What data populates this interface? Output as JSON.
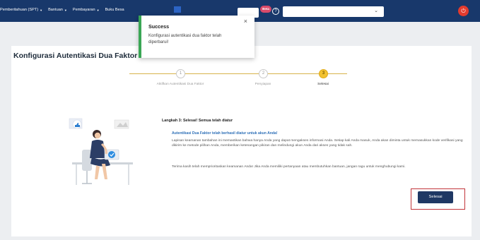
{
  "nav": {
    "items": [
      {
        "label": "Pemberitahuan (SPT)"
      },
      {
        "label": "Bantuan"
      },
      {
        "label": "Pembayaran"
      },
      {
        "label": "Buku Besa"
      }
    ],
    "badge_label": "Beta",
    "dropdown_value": "",
    "select_value": ""
  },
  "toast": {
    "title": "Success",
    "message": "Konfigurasi autentikasi dua faktor telah diperbarui!",
    "close_symbol": "×"
  },
  "page": {
    "title": "Konfigurasi Autentikasi Dua Faktor"
  },
  "stepper": {
    "steps": [
      {
        "number": "1",
        "label": "Aktifkan Autentikasi Dua Faktor",
        "state": "done"
      },
      {
        "number": "2",
        "label": "Penyiapan",
        "state": "done"
      },
      {
        "number": "3",
        "label": "Selesai",
        "state": "active"
      }
    ]
  },
  "content": {
    "step_heading": "Langkah 3: Selesai! Semua telah diatur",
    "sub_heading": "Autentikasi Dua Faktor telah berhasil diatur untuk akun Anda!",
    "paragraph1": "Lapisan keamanan tambahan ini memastikan bahwa hanya Anda yang dapat mengakses informasi Anda. Setiap kali Anda masuk, Anda akan diminta untuk memasukkan kode verifikasi yang dikirim ke metode pilihan Anda, memberikan ketenangan pikiran dan melindungi akun Anda dari akses yang tidak sah.",
    "paragraph2": "Terima kasih telah memprioritaskan keamanan Anda! Jika Anda memiliki pertanyaan atau membutuhkan bantuan, jangan ragu untuk menghubungi kami."
  },
  "actions": {
    "done_label": "Selesai"
  },
  "colors": {
    "navbar": "#18386b",
    "accent_gold": "#f2c230",
    "success_green": "#3aa655",
    "link_blue": "#2d6fb7",
    "button_navy": "#1f3864",
    "highlight_red": "#c2343a"
  },
  "icons": {
    "power": "power-icon",
    "help": "help-icon",
    "close": "close-icon",
    "chevron": "chevron-down-icon"
  }
}
